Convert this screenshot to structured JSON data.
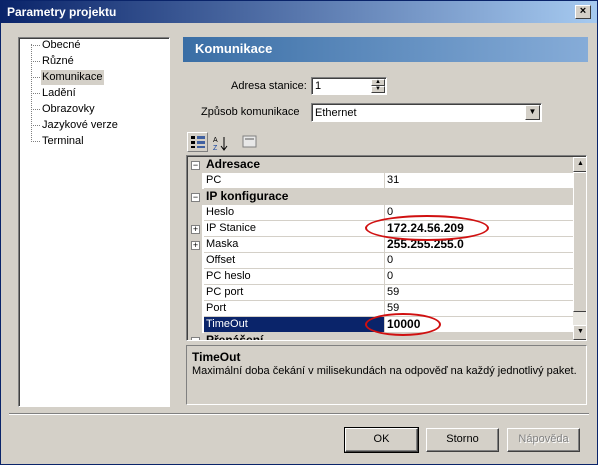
{
  "window": {
    "title": "Parametry projektu"
  },
  "tree": {
    "items": [
      "Obecné",
      "Různé",
      "Komunikace",
      "Ladění",
      "Obrazovky",
      "Jazykové verze",
      "Terminal"
    ]
  },
  "panel": {
    "title": "Komunikace",
    "station_label": "Adresa stanice:",
    "station_value": "1",
    "comm_label": "Způsob komunikace",
    "comm_value": "Ethernet"
  },
  "grid": {
    "categories": {
      "addr": "Adresace",
      "ip": "IP konfigurace",
      "cut": "Přenášení"
    },
    "rows": {
      "pc": {
        "name": "PC",
        "value": "31"
      },
      "heslo": {
        "name": "Heslo",
        "value": "0"
      },
      "ip": {
        "name": "IP Stanice",
        "value": "172.24.56.209"
      },
      "maska": {
        "name": "Maska",
        "value": "255.255.255.0"
      },
      "offset": {
        "name": "Offset",
        "value": "0"
      },
      "pcheslo": {
        "name": "PC heslo",
        "value": "0"
      },
      "pcport": {
        "name": "PC port",
        "value": "59"
      },
      "port": {
        "name": "Port",
        "value": "59"
      },
      "timeout": {
        "name": "TimeOut",
        "value": "10000"
      }
    }
  },
  "help": {
    "title": "TimeOut",
    "text": "Maximální doba čekání v milisekundách  na odpověď na každý jednotlivý paket."
  },
  "buttons": {
    "ok": "OK",
    "cancel": "Storno",
    "help": "Nápověda"
  },
  "colors": {
    "selection": "#0a246a",
    "annotation": "#d01010",
    "header": "#3a6ea5"
  }
}
